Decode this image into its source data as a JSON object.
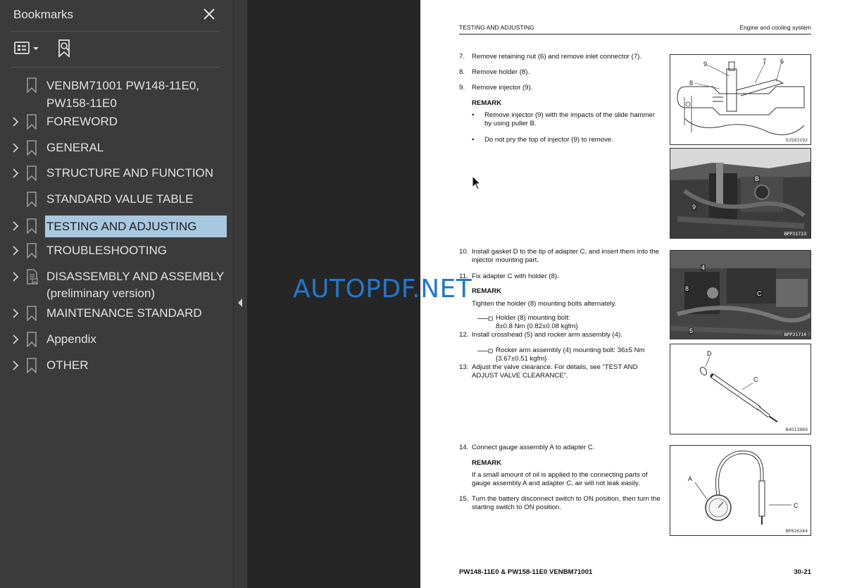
{
  "sidebar": {
    "title": "Bookmarks",
    "close_icon": "close-icon",
    "tools": {
      "options_icon": "bookmark-options-icon",
      "find_icon": "find-current-bookmark-icon"
    },
    "items": [
      {
        "line1": "VENBM71001 PW148-11E0,",
        "line2": "PW158-11E0",
        "expandable": false,
        "icon": "bookmark-icon"
      },
      {
        "line1": "FOREWORD",
        "expandable": true,
        "icon": "bookmark-icon"
      },
      {
        "line1": "GENERAL",
        "expandable": true,
        "icon": "bookmark-icon"
      },
      {
        "line1": "STRUCTURE AND FUNCTION",
        "expandable": true,
        "icon": "bookmark-icon"
      },
      {
        "line1": "STANDARD VALUE TABLE",
        "expandable": false,
        "icon": "bookmark-icon"
      },
      {
        "line1": "TESTING AND ADJUSTING",
        "expandable": true,
        "icon": "bookmark-icon",
        "selected": true
      },
      {
        "line1": "TROUBLESHOOTING",
        "expandable": true,
        "icon": "bookmark-icon"
      },
      {
        "line1": "DISASSEMBLY AND ASSEMBLY",
        "line2": "(preliminary version)",
        "expandable": true,
        "icon": "bookmark-document-icon"
      },
      {
        "line1": "MAINTENANCE STANDARD",
        "expandable": true,
        "icon": "bookmark-icon"
      },
      {
        "line1": "Appendix",
        "expandable": true,
        "icon": "bookmark-icon"
      },
      {
        "line1": "OTHER",
        "expandable": true,
        "icon": "bookmark-icon"
      }
    ]
  },
  "watermark": "AUTOPDF.NET",
  "page": {
    "header_left": "TESTING AND ADJUSTING",
    "header_right": "Engine and cooling system",
    "steps": {
      "s7": {
        "num": "7.",
        "text": "Remove retaining nut (6) and remove inlet connector (7)."
      },
      "s8": {
        "num": "8.",
        "text": "Remove holder (8)."
      },
      "s9": {
        "num": "9.",
        "text": "Remove injector (9)."
      },
      "s10": {
        "num": "10.",
        "text": "Install gasket D to the tip of adapter C, and insert them into the injector mounting part."
      },
      "s11": {
        "num": "11.",
        "text": "Fix adapter C with holder (8)."
      },
      "s12": {
        "num": "12.",
        "text": "Install crosshead (5) and rocker arm assembly (4)."
      },
      "s13": {
        "num": "13.",
        "text": "Adjust the valve clearance. For details, see “TEST AND ADJUST VALVE CLEARANCE”."
      },
      "s14": {
        "num": "14.",
        "text": "Connect gauge assembly A to adapter C."
      },
      "s15": {
        "num": "15.",
        "text": "Turn the battery disconnect switch to ON position, then turn the starting switch to ON position."
      }
    },
    "remark_label": "REMARK",
    "bullets": [
      "Remove injector (9) with the impacts of the slide hammer by using puller B.",
      "Do not pry the top of injector (9) to remove."
    ],
    "note_tighten": "Tighten the holder (8) mounting bolts alternately.",
    "torque1": {
      "line1": "Holder (8) mounting bolt:",
      "line2": "8±0.8 Nm {0.82±0.08 kgfm}"
    },
    "torque2": {
      "line1": "Rocker arm assembly (4) mounting bolt: 36±5 Nm",
      "line2": "{3.67±0.51 kgfm}"
    },
    "note_oil": "If a small amount of oil is applied to the connecting parts of gauge assembly A and adapter C, air will not leak easily.",
    "figures": {
      "fig1": {
        "code": "9JS03192",
        "labels": [
          "9",
          "8",
          "7",
          "6"
        ]
      },
      "fig2": {
        "code": "BPP31713",
        "labels": [
          "B",
          "9"
        ]
      },
      "fig3": {
        "code": "BPP31714",
        "labels": [
          "4",
          "8",
          "C",
          "5"
        ]
      },
      "fig4": {
        "code": "B4G13889",
        "labels": [
          "D",
          "C"
        ]
      },
      "fig5": {
        "code": "BP026344",
        "labels": [
          "A",
          "C"
        ]
      }
    },
    "footer_left": "PW148-11E0 & PW158-11E0   VENBM71001",
    "footer_right": "30-21"
  }
}
